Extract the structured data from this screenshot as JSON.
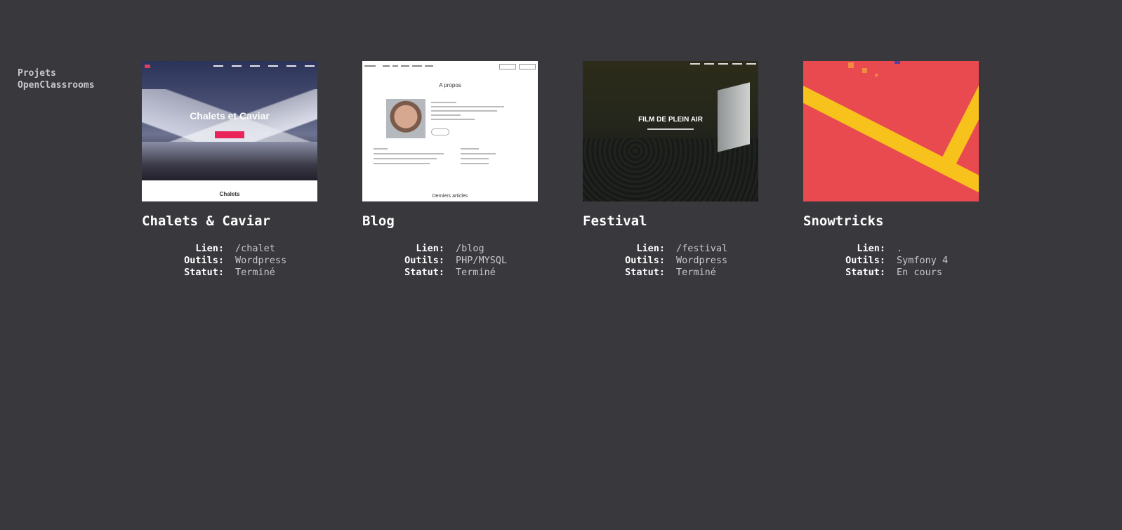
{
  "sidebar": {
    "title": "Projets OpenClassrooms"
  },
  "projects": [
    {
      "title": "Chalets & Caviar",
      "thumb": {
        "heading": "Chalets et Caviar",
        "section": "Chalets"
      },
      "labels": {
        "link": "Lien:",
        "tools": "Outils:",
        "status": "Statut:"
      },
      "link": "/chalet",
      "tools": "Wordpress",
      "status": "Terminé"
    },
    {
      "title": "Blog",
      "thumb": {
        "heading": "A propos",
        "section": "Derniers articles"
      },
      "labels": {
        "link": "Lien:",
        "tools": "Outils:",
        "status": "Statut:"
      },
      "link": "/blog",
      "tools": "PHP/MYSQL",
      "status": "Terminé"
    },
    {
      "title": "Festival",
      "thumb": {
        "heading": "FILM DE PLEIN AIR"
      },
      "labels": {
        "link": "Lien:",
        "tools": "Outils:",
        "status": "Statut:"
      },
      "link": "/festival",
      "tools": "Wordpress",
      "status": "Terminé"
    },
    {
      "title": "Snowtricks",
      "labels": {
        "link": "Lien:",
        "tools": "Outils:",
        "status": "Statut:"
      },
      "link": ".",
      "tools": "Symfony 4",
      "status": "En cours"
    }
  ],
  "colors": {
    "background": "#38383d",
    "text": "#ffffff",
    "muted": "#c9c9cc"
  }
}
